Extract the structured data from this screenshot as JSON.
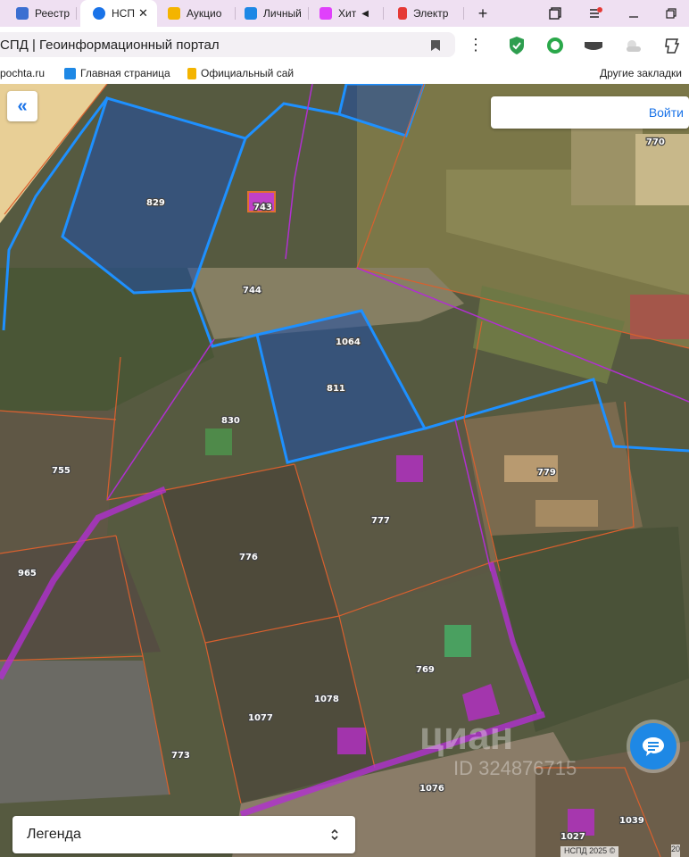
{
  "browser": {
    "tabs": [
      {
        "label": "Реестр",
        "color": "#3b6fd1"
      },
      {
        "label": "НСП",
        "color": "#1a73e8",
        "active": true,
        "close": "✕"
      },
      {
        "label": "Аукцио",
        "color": "#f4b400"
      },
      {
        "label": "Личный",
        "color": "#1e88e5"
      },
      {
        "label": "Хит",
        "color": "#e040fb"
      },
      {
        "label": "Электр",
        "color": "#e53935"
      }
    ],
    "new_tab": "+",
    "address_title": "СПД | Геоинформационный портал",
    "menu_glyph": "⋮",
    "bookmarks": [
      {
        "label": "pochta.ru"
      },
      {
        "label": "Главная страница"
      },
      {
        "label": "Официальный сай"
      }
    ],
    "other_bookmarks": "Другие закладки"
  },
  "map": {
    "collapse_glyph": "«",
    "login_label": "Войти",
    "legend_label": "Легенда",
    "legend_chevron": "⌃⌄",
    "watermark": "циан",
    "watermark_id": "ID 324876715",
    "copyright": "НСПД 2025 ©",
    "scale_label": "20",
    "parcel_labels": [
      "770",
      "829",
      "743",
      "744",
      "1064",
      "811",
      "830",
      "755",
      "779",
      "777",
      "965",
      "776",
      "769",
      "1078",
      "1077",
      "773",
      "1076",
      "1039",
      "1027"
    ],
    "colors": {
      "selected_border": "#1e90ff",
      "selected_fill": "#1f4fa8",
      "parcel_border": "#d9602e",
      "road": "#b030d0",
      "building": "#c040c8"
    }
  }
}
